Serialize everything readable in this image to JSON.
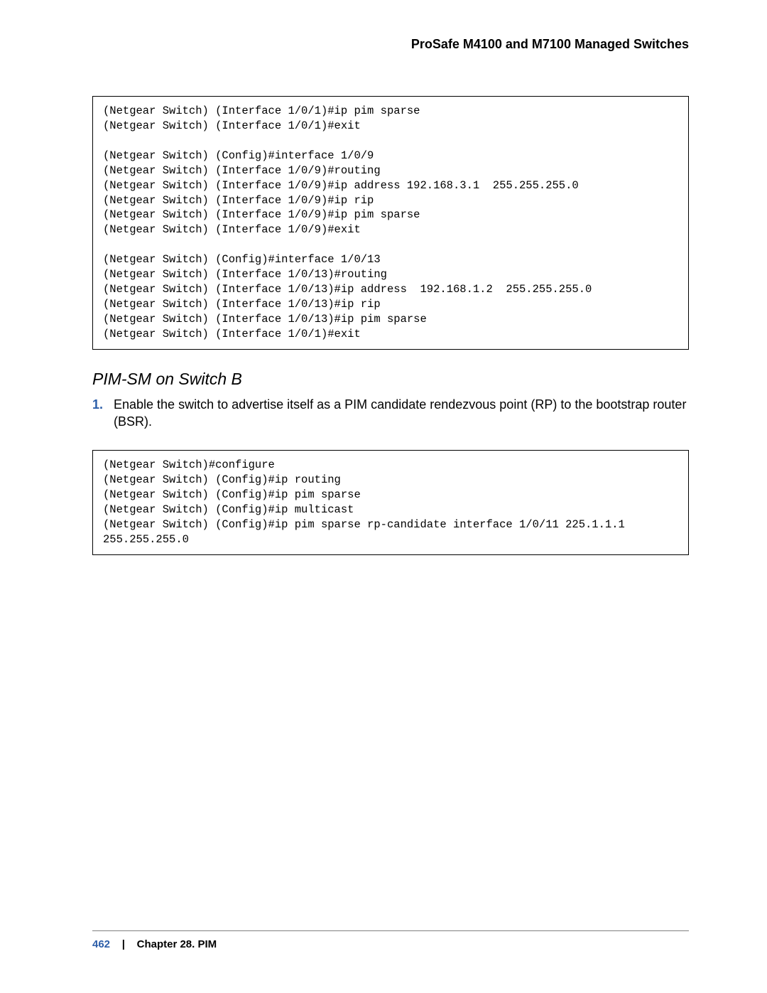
{
  "header": {
    "product_title": "ProSafe M4100 and M7100 Managed Switches"
  },
  "code_block_1": "(Netgear Switch) (Interface 1/0/1)#ip pim sparse\n(Netgear Switch) (Interface 1/0/1)#exit\n\n(Netgear Switch) (Config)#interface 1/0/9\n(Netgear Switch) (Interface 1/0/9)#routing\n(Netgear Switch) (Interface 1/0/9)#ip address 192.168.3.1  255.255.255.0\n(Netgear Switch) (Interface 1/0/9)#ip rip\n(Netgear Switch) (Interface 1/0/9)#ip pim sparse\n(Netgear Switch) (Interface 1/0/9)#exit\n\n(Netgear Switch) (Config)#interface 1/0/13\n(Netgear Switch) (Interface 1/0/13)#routing\n(Netgear Switch) (Interface 1/0/13)#ip address  192.168.1.2  255.255.255.0\n(Netgear Switch) (Interface 1/0/13)#ip rip\n(Netgear Switch) (Interface 1/0/13)#ip pim sparse\n(Netgear Switch) (Interface 1/0/1)#exit",
  "section_title": "PIM-SM on Switch B",
  "step": {
    "number": "1.",
    "text": "Enable the switch to advertise itself as a PIM candidate rendezvous point (RP) to the bootstrap router (BSR)."
  },
  "code_block_2": "(Netgear Switch)#configure\n(Netgear Switch) (Config)#ip routing\n(Netgear Switch) (Config)#ip pim sparse\n(Netgear Switch) (Config)#ip multicast\n(Netgear Switch) (Config)#ip pim sparse rp-candidate interface 1/0/11 225.1.1.1 255.255.255.0",
  "footer": {
    "page_number": "462",
    "separator": "|",
    "chapter": "Chapter 28.  PIM"
  }
}
